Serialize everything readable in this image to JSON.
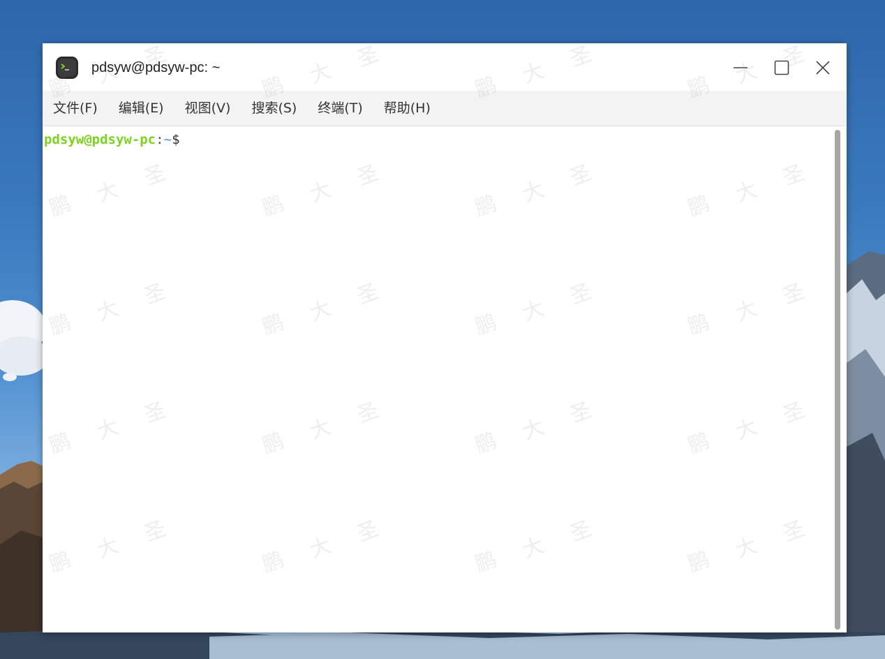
{
  "window": {
    "title": "pdsyw@pdsyw-pc: ~",
    "app_icon": "terminal-icon",
    "controls": {
      "minimize": "minimize-icon",
      "maximize": "maximize-icon",
      "close": "close-icon"
    }
  },
  "menu": {
    "items": [
      {
        "label": "文件(F)"
      },
      {
        "label": "编辑(E)"
      },
      {
        "label": "视图(V)"
      },
      {
        "label": "搜索(S)"
      },
      {
        "label": "终端(T)"
      },
      {
        "label": "帮助(H)"
      }
    ]
  },
  "terminal": {
    "prompt_user": "pdsyw@pdsyw-pc",
    "prompt_sep": ":",
    "prompt_path": "~",
    "prompt_symbol": "$",
    "colors": {
      "user": "#7ed321",
      "path": "#4a90d9"
    }
  },
  "watermark": {
    "chars": [
      "鹏",
      "大",
      "圣"
    ]
  }
}
